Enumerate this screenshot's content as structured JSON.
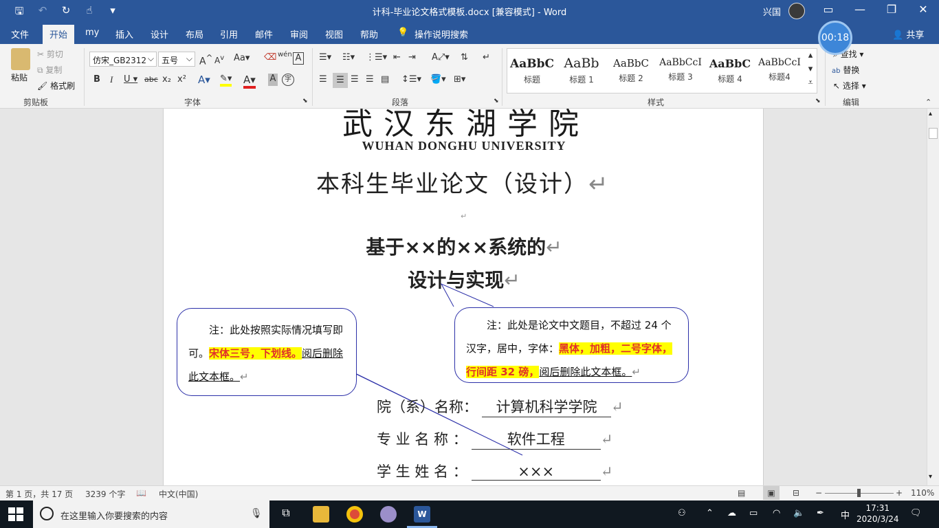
{
  "titlebar": {
    "doc_title": "计科-毕业论文格式模板.docx [兼容模式]  -  Word",
    "user": "兴国",
    "timer": "00:18"
  },
  "tabs": [
    "文件",
    "开始",
    "my",
    "插入",
    "设计",
    "布局",
    "引用",
    "邮件",
    "审阅",
    "视图",
    "帮助",
    "操作说明搜索"
  ],
  "share": "共享",
  "ribbon": {
    "clipboard": {
      "paste": "粘贴",
      "cut": "剪切",
      "copy": "复制",
      "format_painter": "格式刷",
      "label": "剪贴板"
    },
    "font": {
      "name": "仿宋_GB2312",
      "size": "五号",
      "label": "字体",
      "bold": "B",
      "italic": "I",
      "underline": "U",
      "strike": "abc",
      "sub": "x₂",
      "sup": "x²",
      "case": "Aa",
      "grow": "A",
      "shrink": "A",
      "pinyin": "wén",
      "border_char": "A",
      "shade_char": "A",
      "circle_char": "字"
    },
    "paragraph": {
      "label": "段落"
    },
    "styles": {
      "label": "样式",
      "items": [
        {
          "preview": "AaBbC",
          "name": "标题"
        },
        {
          "preview": "AaBb",
          "name": "标题 1"
        },
        {
          "preview": "AaBbC",
          "name": "标题 2"
        },
        {
          "preview": "AaBbCcI",
          "name": "标题 3"
        },
        {
          "preview": "AaBbC",
          "name": "标题 4"
        },
        {
          "preview": "AaBbCcI",
          "name": "标题4"
        }
      ]
    },
    "editing": {
      "find": "查找",
      "replace": "替换",
      "select": "选择",
      "label": "编辑"
    }
  },
  "document": {
    "logo_cn": "武汉东湖学院",
    "logo_en": "WUHAN DONGHU UNIVERSITY",
    "main_title": "本科生毕业论文（设计）",
    "thesis_title_1": "基于××的××系统的",
    "thesis_title_2": "设计与实现",
    "callout_left": {
      "text1": "注：此处按照实际情况填写即可。",
      "highlight": "宋体三号，下划线。",
      "text2": "阅后删除此文本框。"
    },
    "callout_right": {
      "text1": "注：此处是论文中文题目，不超过 24 个汉字，居中，字体：",
      "highlight": "黑体，加粗，二号字体，行间距 32 磅，",
      "text2": "阅后删除此文本框。"
    },
    "form": [
      {
        "label": "院（系）名称：",
        "value": "计算机科学学院"
      },
      {
        "label": "专 业 名 称 ：",
        "value": "软件工程"
      },
      {
        "label": "学 生 姓 名 ：",
        "value": "×××"
      }
    ]
  },
  "statusbar": {
    "page": "第 1 页，共 17 页",
    "words": "3239 个字",
    "language": "中文(中国)",
    "zoom": "110%"
  },
  "taskbar": {
    "search_placeholder": "在这里输入你要搜索的内容",
    "ime": "中",
    "time": "17:31",
    "date": "2020/3/24"
  }
}
